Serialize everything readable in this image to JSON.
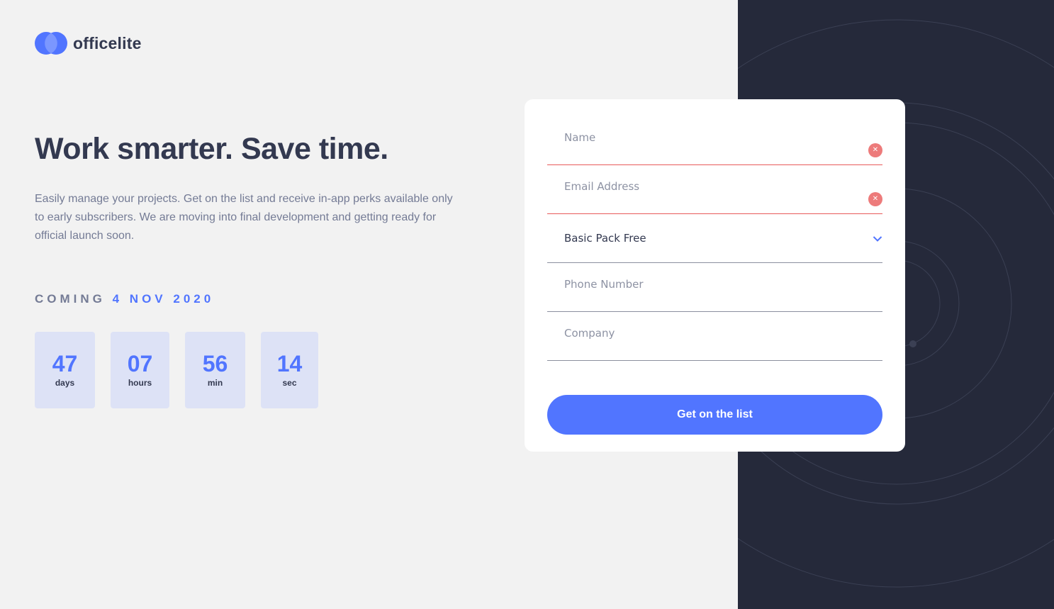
{
  "brand": {
    "name": "officelite"
  },
  "hero": {
    "headline": "Work smarter. Save time.",
    "description": "Easily manage your projects. Get on the list and receive in-app perks available only to early subscribers. We are moving into final development and getting ready for official launch soon."
  },
  "launch": {
    "coming_label": "COMING",
    "date": "4 NOV 2020"
  },
  "countdown": [
    {
      "value": "47",
      "unit": "days"
    },
    {
      "value": "07",
      "unit": "hours"
    },
    {
      "value": "56",
      "unit": "min"
    },
    {
      "value": "14",
      "unit": "sec"
    }
  ],
  "form": {
    "name": {
      "placeholder": "Name",
      "value": "",
      "error": true
    },
    "email": {
      "placeholder": "Email Address",
      "value": "",
      "error": true
    },
    "pack": {
      "selected": "Basic Pack Free"
    },
    "phone": {
      "placeholder": "Phone Number",
      "value": ""
    },
    "company": {
      "placeholder": "Company",
      "value": ""
    },
    "submit_label": "Get on the list"
  },
  "colors": {
    "accent": "#5175ff",
    "dark": "#25293a",
    "heading": "#333950",
    "body_text": "#747b95",
    "error": "#e85a5a",
    "countdown_bg": "#dde2f6"
  },
  "icons": [
    "logo-mark-icon",
    "error-x-icon",
    "chevron-down-icon"
  ]
}
